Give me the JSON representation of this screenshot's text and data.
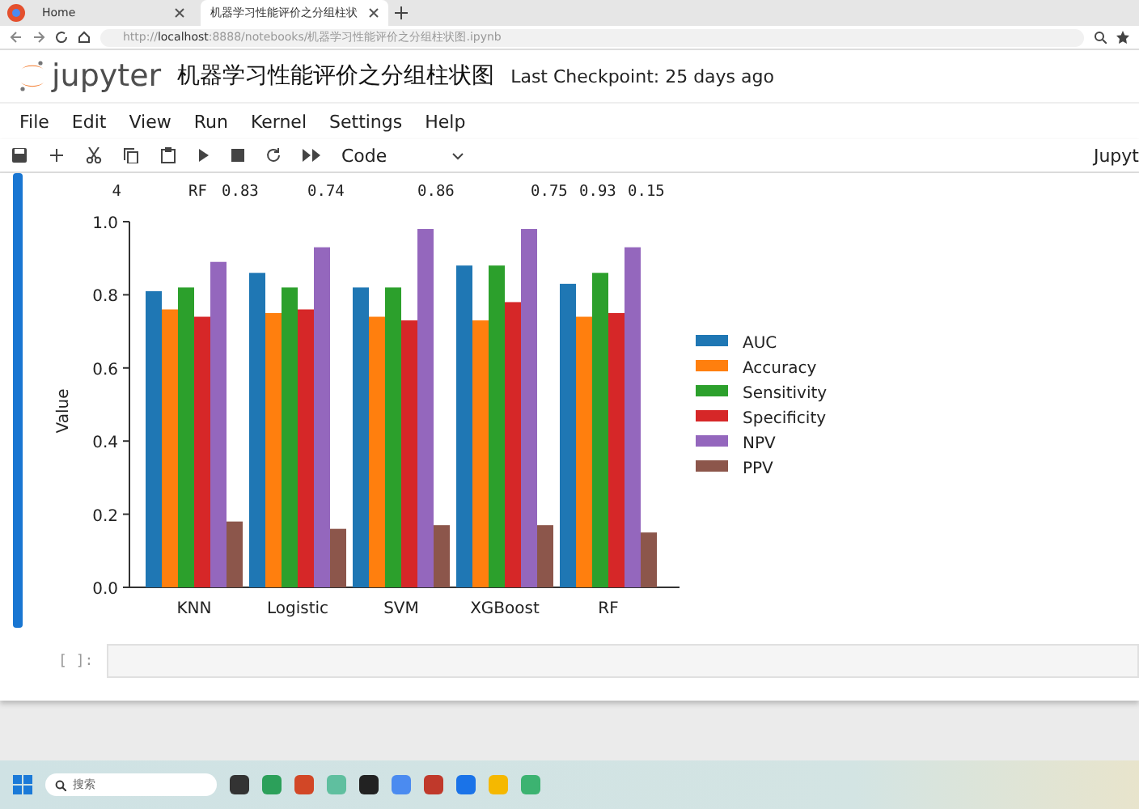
{
  "browser": {
    "tabs": [
      {
        "label": "Home",
        "selected": false
      },
      {
        "label": "机器学习性能评价之分组柱状",
        "selected": true
      }
    ],
    "url": "http://**localhost**:8888/notebooks/机器学习性能评价之分组柱状图.ipynb"
  },
  "header": {
    "logo": "jupyter",
    "title": "机器学习性能评价之分组柱状图",
    "checkpoint": "Last Checkpoint: 25 days ago"
  },
  "menu": [
    "File",
    "Edit",
    "View",
    "Run",
    "Kernel",
    "Settings",
    "Help"
  ],
  "toolbar": {
    "cell_type": "Code",
    "kernel": "Jupyt"
  },
  "output_table": {
    "rows": [
      [
        "4",
        "RF",
        "0.83",
        "0.74",
        "0.86",
        "0.75",
        "0.93",
        "0.15"
      ]
    ]
  },
  "chart_data": {
    "type": "bar",
    "ylabel": "Value",
    "categories": [
      "KNN",
      "Logistic",
      "SVM",
      "XGBoost",
      "RF"
    ],
    "ylim": [
      0,
      1
    ],
    "yticks": [
      {
        "value": 0,
        "label": "0.0"
      },
      {
        "value": 0.2,
        "label": "0.2"
      },
      {
        "value": 0.4,
        "label": "0.4"
      },
      {
        "value": 0.6,
        "label": "0.6"
      },
      {
        "value": 0.8,
        "label": "0.8"
      },
      {
        "value": 1,
        "label": "1.0"
      }
    ],
    "legend": true,
    "series": [
      {
        "name": "AUC",
        "color": "#1f77b4",
        "values": [
          0.81,
          0.86,
          0.82,
          0.88,
          0.83
        ]
      },
      {
        "name": "Accuracy",
        "color": "#ff7f0e",
        "values": [
          0.76,
          0.75,
          0.74,
          0.73,
          0.74
        ]
      },
      {
        "name": "Sensitivity",
        "color": "#2ca02c",
        "values": [
          0.82,
          0.82,
          0.82,
          0.88,
          0.86
        ]
      },
      {
        "name": "Specificity",
        "color": "#d62728",
        "values": [
          0.74,
          0.76,
          0.73,
          0.78,
          0.75
        ]
      },
      {
        "name": "NPV",
        "color": "#9467bd",
        "values": [
          0.89,
          0.93,
          0.98,
          0.98,
          0.93
        ]
      },
      {
        "name": "PPV",
        "color": "#8c564b",
        "values": [
          0.18,
          0.16,
          0.17,
          0.17,
          0.15
        ]
      }
    ]
  },
  "empty_cell": {
    "prompt": "[ ]:"
  },
  "taskbar": {
    "search_placeholder": "搜索"
  }
}
